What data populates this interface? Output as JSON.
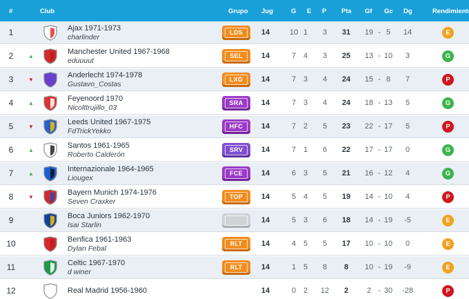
{
  "headers": {
    "pos": "#",
    "club": "Club",
    "group": "Grupo",
    "jug": "Jug",
    "g": "G",
    "e": "E",
    "p": "P",
    "pts": "Pts",
    "gf": "Gf",
    "gc": "Gc",
    "dg": "Dg",
    "rend": "Rendimiento"
  },
  "colors": {
    "header": "#1aa0d8",
    "row_alt": "#e9eff4",
    "trend_up": "#3bb54a",
    "trend_down": "#d01f2b",
    "rend_E": "#f2a11f",
    "rend_G": "#3bb54a",
    "rend_P": "#d0161e"
  },
  "rows": [
    {
      "pos": "1",
      "trend": "",
      "club": "Ajax 1971-1973",
      "user": "charlinder",
      "group": "LDS",
      "badge": "orange",
      "crest": [
        "#ffffff",
        "#e03030"
      ],
      "jug": "14",
      "g": "10",
      "e": "1",
      "p": "3",
      "pts": "31",
      "gf": "19",
      "gc": "5",
      "dg": "14",
      "rend": "E"
    },
    {
      "pos": "2",
      "trend": "up",
      "club": "Manchester United 1967-1968",
      "user": "eduuuut",
      "group": "SEL",
      "badge": "orange",
      "crest": [
        "#d62828",
        "#b51f1f"
      ],
      "jug": "14",
      "g": "7",
      "e": "4",
      "p": "3",
      "pts": "25",
      "gf": "13",
      "gc": "10",
      "dg": "3",
      "rend": "G"
    },
    {
      "pos": "3",
      "trend": "down",
      "club": "Anderlecht 1974-1978",
      "user": "Gustavo_Costas",
      "group": "LXG",
      "badge": "orange",
      "crest": [
        "#6a3fcf",
        "#6a3fcf"
      ],
      "jug": "14",
      "g": "7",
      "e": "3",
      "p": "4",
      "pts": "24",
      "gf": "15",
      "gc": "8",
      "dg": "7",
      "rend": "P"
    },
    {
      "pos": "4",
      "trend": "up",
      "club": "Feyenoord 1970",
      "user": "Nicolttrujillo_03",
      "group": "SRA",
      "badge": "purple",
      "crest": [
        "#e03030",
        "#ffffff"
      ],
      "jug": "14",
      "g": "7",
      "e": "3",
      "p": "4",
      "pts": "24",
      "gf": "18",
      "gc": "13",
      "dg": "5",
      "rend": "G"
    },
    {
      "pos": "5",
      "trend": "down",
      "club": "Leeds United 1967-1975",
      "user": "FdTrickYekko",
      "group": "HFC",
      "badge": "purple",
      "crest": [
        "#2a5fc8",
        "#f2c300"
      ],
      "jug": "14",
      "g": "7",
      "e": "2",
      "p": "5",
      "pts": "23",
      "gf": "22",
      "gc": "17",
      "dg": "5",
      "rend": "P"
    },
    {
      "pos": "6",
      "trend": "up",
      "club": "Santos 1961-1965",
      "user": "Roberto Calderón",
      "group": "SRV",
      "badge": "violet",
      "crest": [
        "#ffffff",
        "#222222"
      ],
      "jug": "14",
      "g": "7",
      "e": "1",
      "p": "6",
      "pts": "22",
      "gf": "17",
      "gc": "17",
      "dg": "0",
      "rend": "G"
    },
    {
      "pos": "7",
      "trend": "up",
      "club": "Internazionale 1964-1965",
      "user": "Liougex",
      "group": "FCE",
      "badge": "purple",
      "crest": [
        "#1a5fd8",
        "#111111"
      ],
      "jug": "14",
      "g": "6",
      "e": "3",
      "p": "5",
      "pts": "21",
      "gf": "16",
      "gc": "12",
      "dg": "4",
      "rend": "G"
    },
    {
      "pos": "8",
      "trend": "down",
      "club": "Bayern Munich 1974-1976",
      "user": "Seven Craxker",
      "group": "TOP",
      "badge": "orange",
      "crest": [
        "#d62828",
        "#1a4fb8"
      ],
      "jug": "14",
      "g": "5",
      "e": "4",
      "p": "5",
      "pts": "19",
      "gf": "14",
      "gc": "10",
      "dg": "4",
      "rend": "P"
    },
    {
      "pos": "9",
      "trend": "",
      "club": "Boca Juniors 1962-1970",
      "user": "Isai Starlin",
      "group": "",
      "badge": "grey",
      "crest": [
        "#1a3f9a",
        "#f2c300"
      ],
      "jug": "14",
      "g": "5",
      "e": "3",
      "p": "6",
      "pts": "18",
      "gf": "14",
      "gc": "19",
      "dg": "-5",
      "rend": "E"
    },
    {
      "pos": "10",
      "trend": "",
      "club": "Benfica 1961-1963",
      "user": "Dylan Febal",
      "group": "RLT",
      "badge": "orange",
      "crest": [
        "#d62828",
        "#b51f1f"
      ],
      "jug": "14",
      "g": "4",
      "e": "5",
      "p": "5",
      "pts": "17",
      "gf": "10",
      "gc": "10",
      "dg": "0",
      "rend": "E"
    },
    {
      "pos": "11",
      "trend": "",
      "club": "Celtic 1967-1970",
      "user": "d winer",
      "group": "RLT",
      "badge": "orange",
      "crest": [
        "#1a9a4a",
        "#ffffff"
      ],
      "jug": "14",
      "g": "1",
      "e": "5",
      "p": "8",
      "pts": "8",
      "gf": "10",
      "gc": "19",
      "dg": "-9",
      "rend": "E"
    },
    {
      "pos": "12",
      "trend": "",
      "club": "Real Madrid 1956-1960",
      "user": "",
      "group": "",
      "badge": "none",
      "crest": [
        "#ffffff",
        "#ffffff"
      ],
      "jug": "14",
      "g": "0",
      "e": "2",
      "p": "12",
      "pts": "2",
      "gf": "2",
      "gc": "30",
      "dg": "-28",
      "rend": "P"
    }
  ]
}
